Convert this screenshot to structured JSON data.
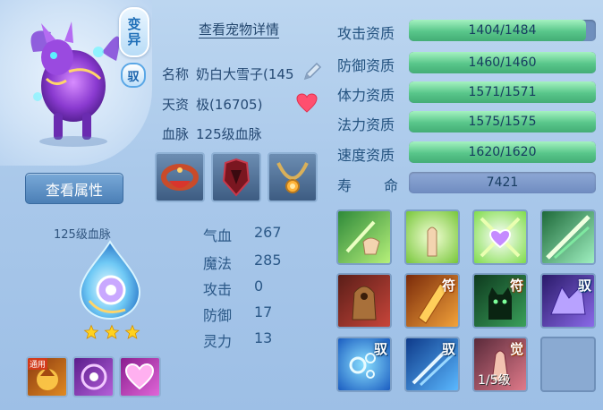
{
  "header": {
    "title": "查看宠物详情"
  },
  "pet": {
    "badge_mutation": [
      "变",
      "异"
    ],
    "badge_bound": "驭",
    "name_label": "名称",
    "name_value": "奶白大雪子(145",
    "talent_label": "天资",
    "talent_value": "极(16705)",
    "bloodline_label": "血脉",
    "bloodline_value": "125级血脉",
    "view_attrs_button": "查看属性"
  },
  "bloodline_panel": {
    "label": "125级血脉",
    "stars": 3,
    "small_skill_tag": "通用"
  },
  "stats": [
    {
      "label": "气血",
      "value": "267"
    },
    {
      "label": "魔法",
      "value": "285"
    },
    {
      "label": "攻击",
      "value": "0"
    },
    {
      "label": "防御",
      "value": "17"
    },
    {
      "label": "灵力",
      "value": "13"
    }
  ],
  "aptitudes": [
    {
      "label": "攻击资质",
      "current": 1404,
      "max": 1484,
      "text": "1404/1484"
    },
    {
      "label": "防御资质",
      "current": 1460,
      "max": 1460,
      "text": "1460/1460"
    },
    {
      "label": "体力资质",
      "current": 1571,
      "max": 1571,
      "text": "1571/1571"
    },
    {
      "label": "法力资质",
      "current": 1575,
      "max": 1575,
      "text": "1575/1575"
    },
    {
      "label": "速度资质",
      "current": 1620,
      "max": 1620,
      "text": "1620/1620"
    }
  ],
  "lifespan": {
    "label_1": "寿",
    "label_2": "命",
    "value": "7421"
  },
  "skills": {
    "tags": {
      "fu": "符",
      "yu": "驭",
      "jue": "觉"
    },
    "level_text": "1/5级"
  },
  "colors": {
    "bar_fill": "#58c68a",
    "bar_track": "#6f8fbd",
    "panel_bg": "#a9c8ea",
    "text": "#264a74"
  }
}
